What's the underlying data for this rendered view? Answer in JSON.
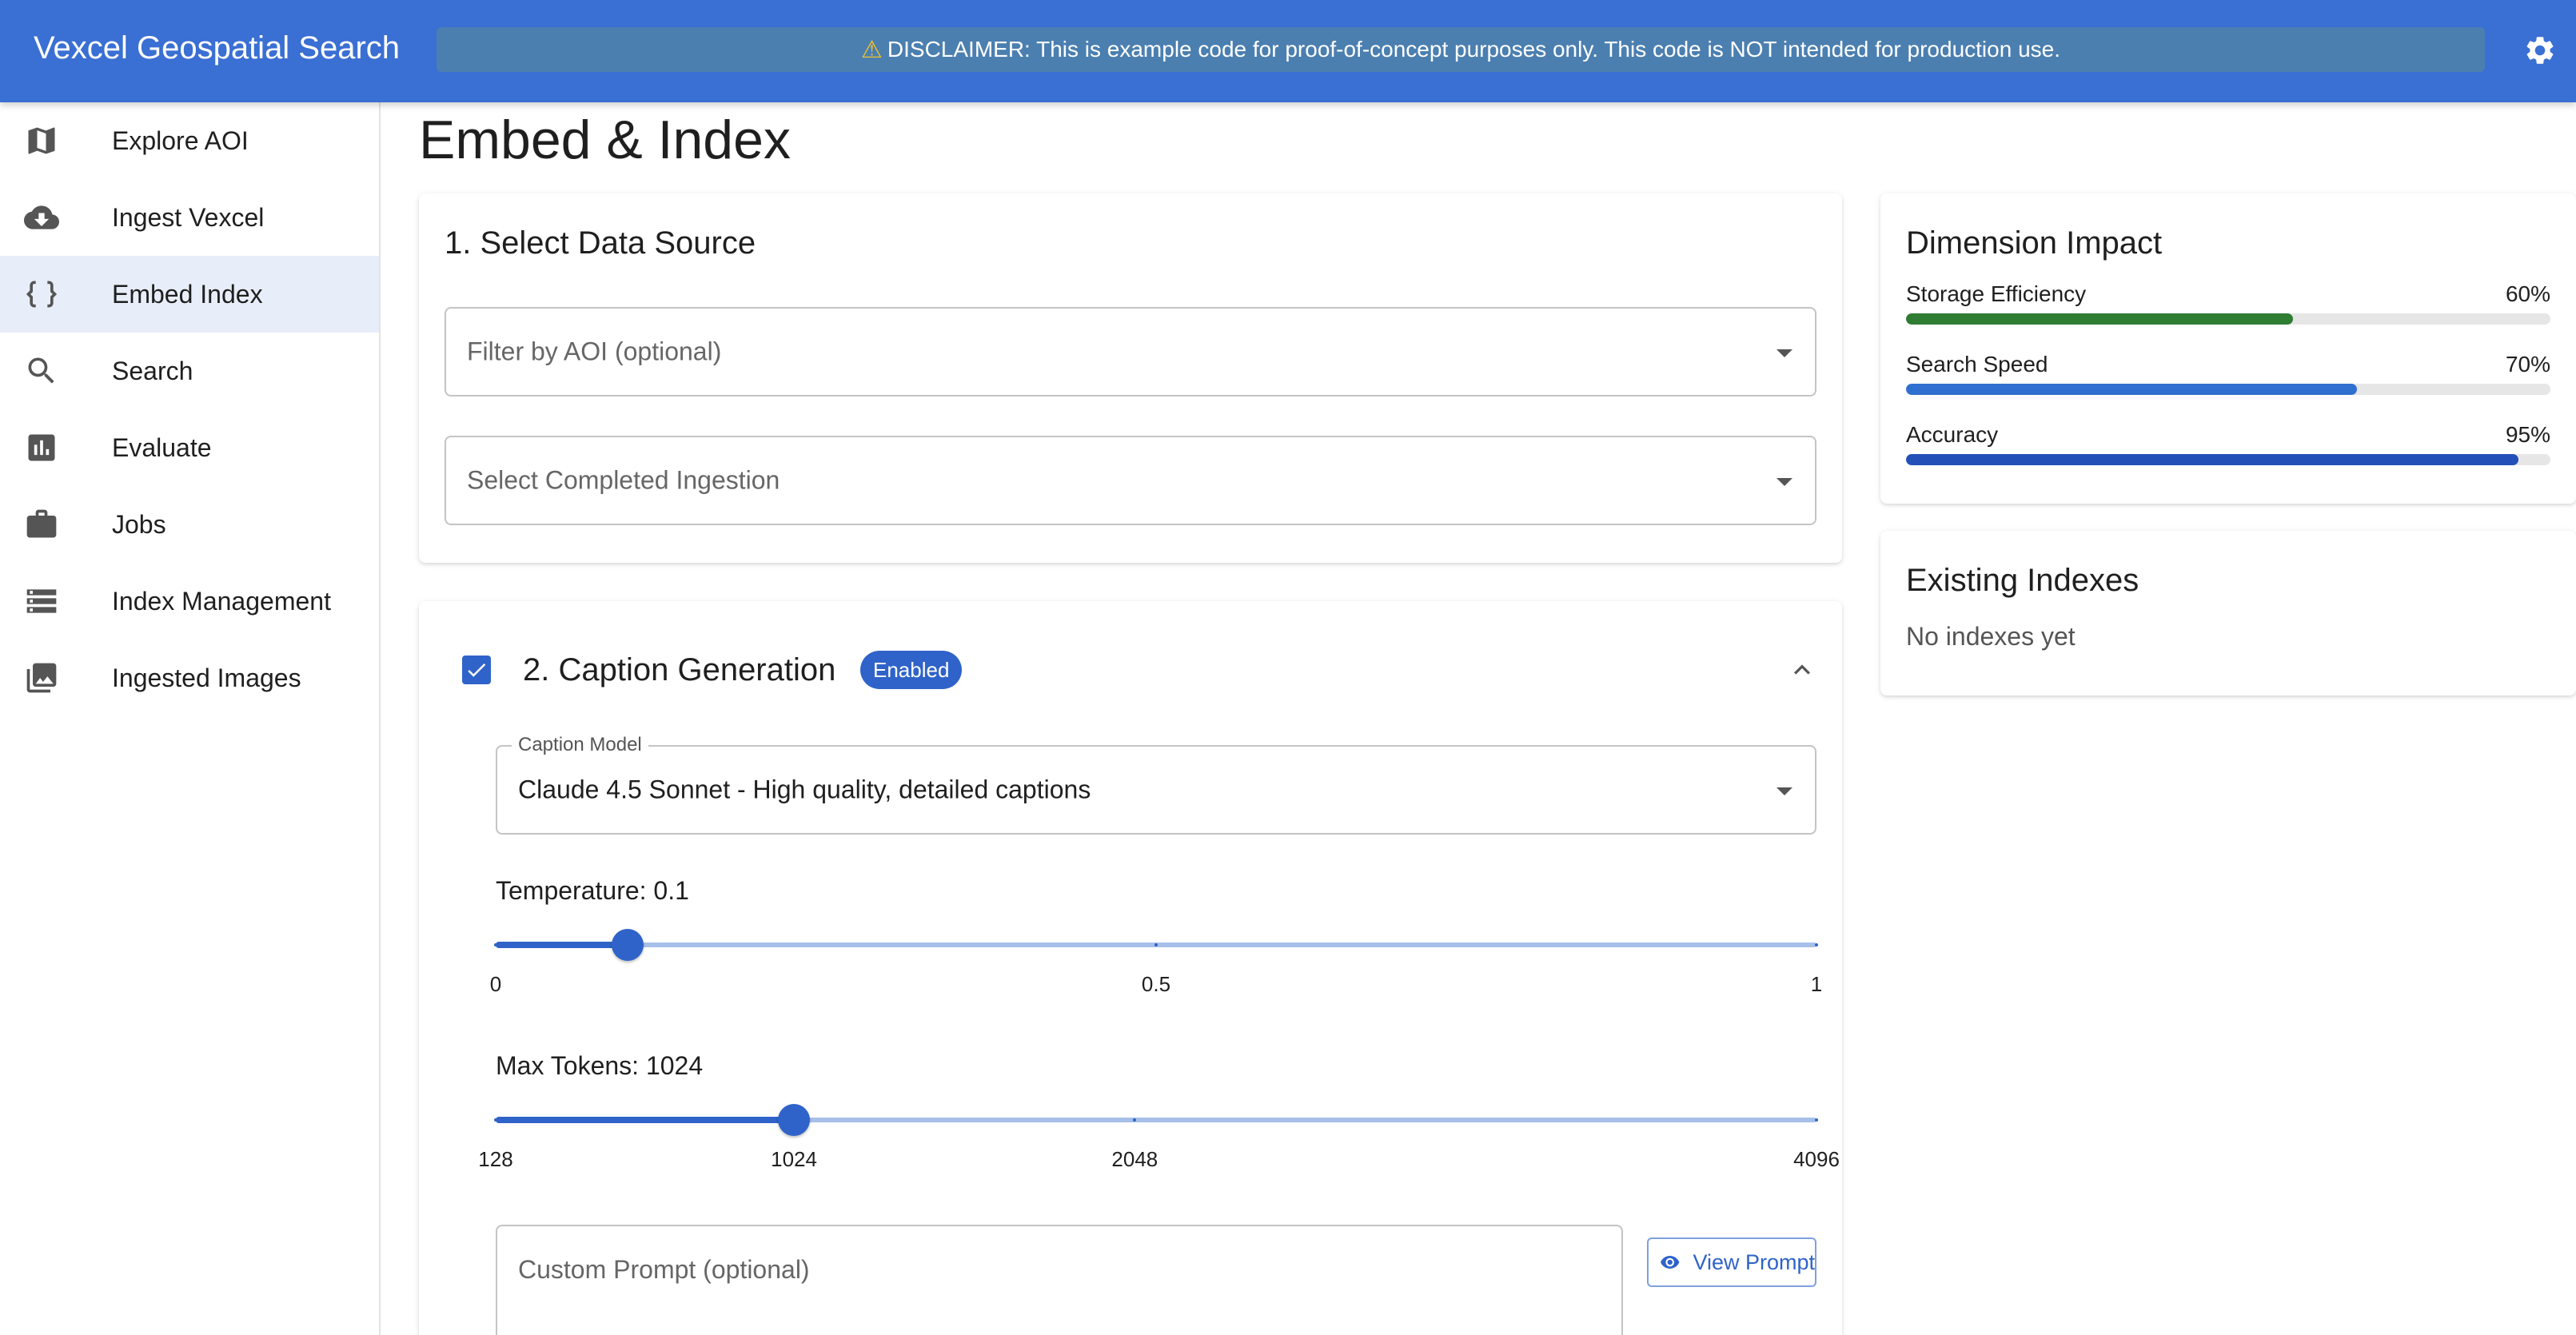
{
  "app": {
    "title": "Vexcel Geospatial Search",
    "disclaimer": "DISCLAIMER: This is example code for proof-of-concept purposes only. This code is NOT intended for production use.",
    "settings_icon": "gear-icon",
    "brand_color": "#3a6fd3"
  },
  "sidebar": {
    "items": [
      {
        "label": "Explore AOI",
        "icon": "map-icon",
        "active": false
      },
      {
        "label": "Ingest Vexcel",
        "icon": "cloud-download-icon",
        "active": false
      },
      {
        "label": "Embed Index",
        "icon": "braces-icon",
        "active": true
      },
      {
        "label": "Search",
        "icon": "search-icon",
        "active": false
      },
      {
        "label": "Evaluate",
        "icon": "bar-chart-icon",
        "active": false
      },
      {
        "label": "Jobs",
        "icon": "briefcase-icon",
        "active": false
      },
      {
        "label": "Index Management",
        "icon": "storage-icon",
        "active": false
      },
      {
        "label": "Ingested Images",
        "icon": "image-library-icon",
        "active": false
      }
    ]
  },
  "page": {
    "title": "Embed & Index"
  },
  "data_source": {
    "title": "1. Select Data Source",
    "aoi_filter": {
      "placeholder": "Filter by AOI (optional)",
      "value": ""
    },
    "ingestion_select": {
      "placeholder": "Select Completed Ingestion",
      "value": ""
    }
  },
  "caption": {
    "title": "2. Caption Generation",
    "enabled": true,
    "badge": "Enabled",
    "model": {
      "label": "Caption Model",
      "value": "Claude 4.5 Sonnet - High quality, detailed captions"
    },
    "temperature": {
      "label": "Temperature: 0.1",
      "value": 0.1,
      "min": 0,
      "max": 1,
      "marks": [
        {
          "value": 0,
          "label": "0"
        },
        {
          "value": 0.5,
          "label": "0.5"
        },
        {
          "value": 1,
          "label": "1"
        }
      ]
    },
    "max_tokens": {
      "label": "Max Tokens: 1024",
      "value": 1024,
      "min": 128,
      "max": 4096,
      "marks": [
        {
          "value": 128,
          "label": "128"
        },
        {
          "value": 1024,
          "label": "1024"
        },
        {
          "value": 2048,
          "label": "2048"
        },
        {
          "value": 4096,
          "label": "4096"
        }
      ]
    },
    "custom_prompt": {
      "placeholder": "Custom Prompt (optional)",
      "value": ""
    },
    "view_prompt": "View Prompt"
  },
  "dimension_impact": {
    "title": "Dimension Impact",
    "metrics": [
      {
        "label": "Storage Efficiency",
        "value": 60,
        "display": "60%",
        "color": "#2e7d32"
      },
      {
        "label": "Search Speed",
        "value": 70,
        "display": "70%",
        "color": "#2f6fd0"
      },
      {
        "label": "Accuracy",
        "value": 95,
        "display": "95%",
        "color": "#2350b8"
      }
    ]
  },
  "existing_indexes": {
    "title": "Existing Indexes",
    "empty": "No indexes yet"
  }
}
